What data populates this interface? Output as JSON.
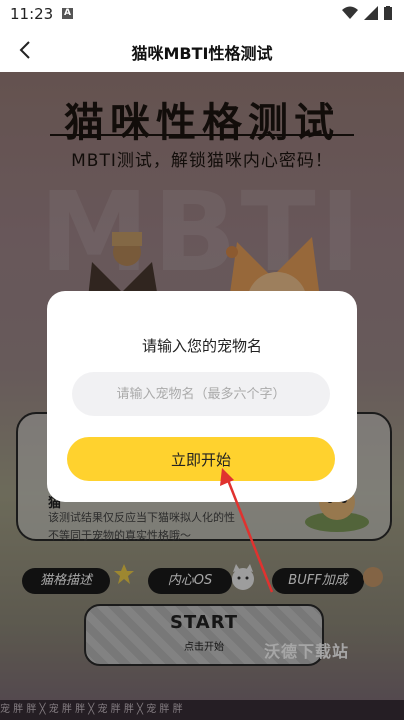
{
  "status_bar": {
    "time": "11:23",
    "notification_badge": "A",
    "icons": [
      "wifi-icon",
      "signal-icon",
      "battery-icon"
    ]
  },
  "app_bar": {
    "title": "猫咪MBTI性格测试",
    "back_icon": "back-arrow-icon"
  },
  "hero": {
    "title": "猫咪性格测试",
    "subtitle": "MBTI测试，解锁猫咪内心密码！",
    "watermark": "MBTI"
  },
  "card": {
    "heading": "猫",
    "desc_line1": "该测试结果仅反应当下猫咪拟人化的性",
    "desc_line2": "不等同于宠物的真实性格哦～"
  },
  "tags": [
    "猫格描述",
    "内心OS",
    "BUFF加成"
  ],
  "start_button": {
    "label": "START",
    "sublabel": "点击开始"
  },
  "site_watermark": "沃德下载站",
  "bottom_ticker": "宠 胖 胖  ╳  宠 胖 胖  ╳  宠 胖 胖  ╳  宠 胖 胖",
  "dialog": {
    "title": "请输入您的宠物名",
    "input_placeholder": "请输入宠物名（最多六个字）",
    "input_value": "",
    "confirm_label": "立即开始"
  },
  "colors": {
    "accent": "#ffd22e",
    "arrow": "#e0322f"
  }
}
